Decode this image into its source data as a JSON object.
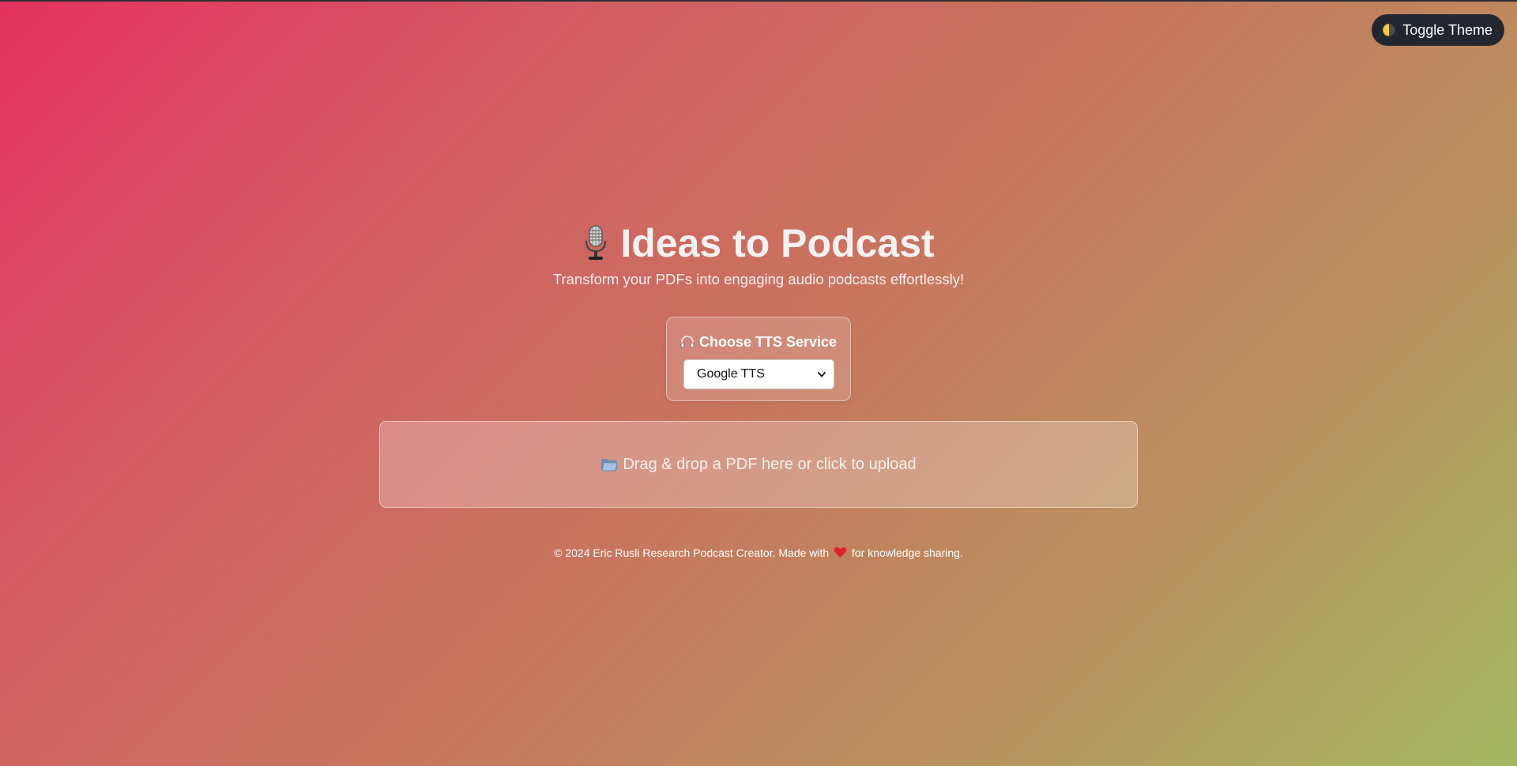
{
  "header": {
    "toggle_theme_label": "Toggle Theme",
    "toggle_theme_icon": "moon-icon"
  },
  "hero": {
    "title": "Ideas to Podcast",
    "title_icon": "microphone-icon",
    "subtitle": "Transform your PDFs into engaging audio podcasts effortlessly!"
  },
  "tts": {
    "label": "Choose TTS Service",
    "label_icon": "headphones-icon",
    "selected": "Google TTS"
  },
  "upload": {
    "label": "Drag & drop a PDF here or click to upload",
    "icon": "folder-icon"
  },
  "footer": {
    "text_before": "© 2024 Eric Rusli Research Podcast Creator. Made with",
    "icon": "heart-icon",
    "text_after": "for knowledge sharing."
  },
  "colors": {
    "gradient_start": "#e53160",
    "gradient_end": "#a4b862",
    "toggle_bg": "#22262e",
    "heart": "#e0202e"
  }
}
